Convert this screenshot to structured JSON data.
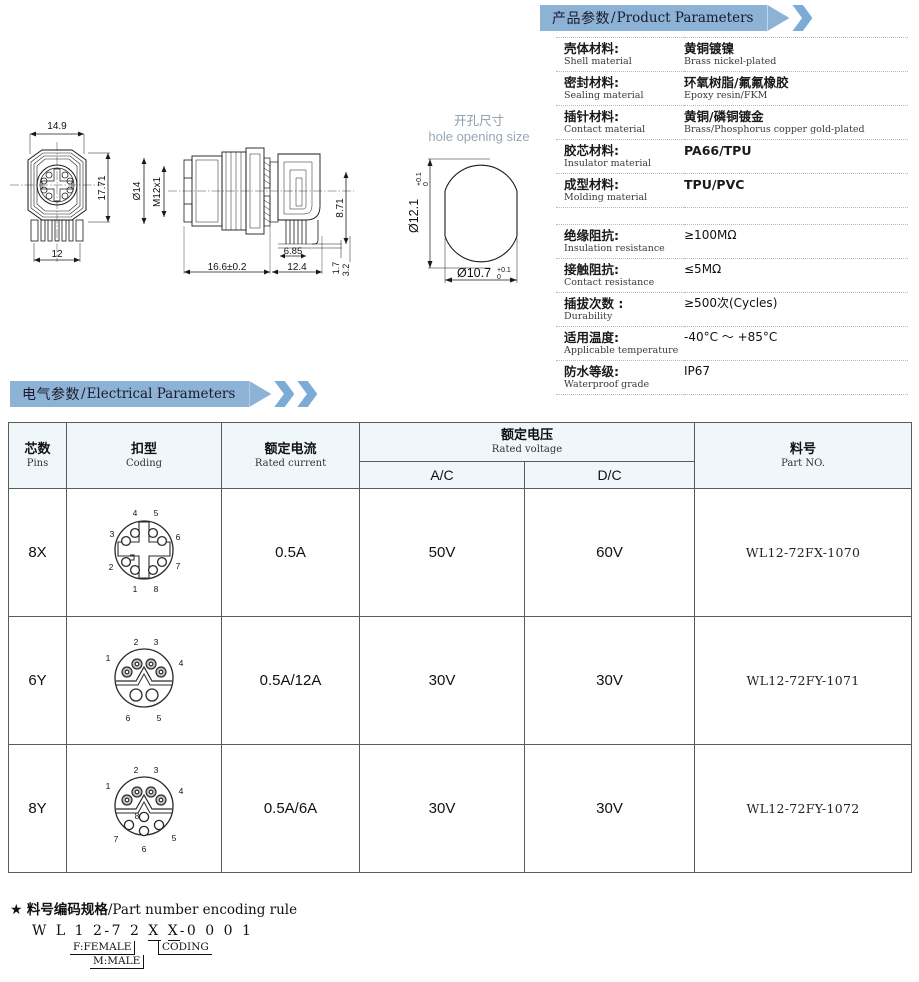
{
  "product_parameters": {
    "banner": {
      "cn": "产品参数",
      "sep": "/",
      "en": "Product Parameters"
    },
    "materials": [
      {
        "label_cn": "壳体材料:",
        "label_en": "Shell material",
        "value_cn": "黄铜镀镍",
        "value_en": "Brass nickel-plated"
      },
      {
        "label_cn": "密封材料:",
        "label_en": "Sealing material",
        "value_cn": "环氧树脂/氟氟橡胶",
        "value_en": "Epoxy resin/FKM"
      },
      {
        "label_cn": "插针材料:",
        "label_en": "Contact material",
        "value_cn": "黄铜/磷铜镀金",
        "value_en": "Brass/Phosphorus copper gold-plated"
      },
      {
        "label_cn": "胶芯材料:",
        "label_en": "Insulator material",
        "value_cn": "PA66/TPU",
        "value_en": ""
      },
      {
        "label_cn": "成型材料:",
        "label_en": "Molding material",
        "value_cn": "TPU/PVC",
        "value_en": ""
      }
    ],
    "specs": [
      {
        "label_cn": "绝缘阻抗:",
        "label_en": "Insulation resistance",
        "value": "≥100MΩ"
      },
      {
        "label_cn": "接触阻抗:",
        "label_en": "Contact resistance",
        "value": "≤5MΩ"
      },
      {
        "label_cn": "插拔次数 :",
        "label_en": "Durability",
        "value": "≥500次(Cycles)"
      },
      {
        "label_cn": "适用温度:",
        "label_en": "Applicable temperature",
        "value": "-40°C ～ +85°C"
      },
      {
        "label_cn": "防水等级:",
        "label_en": "Waterproof grade",
        "value": "IP67"
      }
    ]
  },
  "electrical_parameters": {
    "banner": {
      "cn": "电气参数",
      "sep": "/",
      "en": "Electrical Parameters"
    },
    "headers": {
      "pins_cn": "芯数",
      "pins_en": "Pins",
      "coding_cn": "扣型",
      "coding_en": "Coding",
      "current_cn": "额定电流",
      "current_en": "Rated current",
      "voltage_cn": "额定电压",
      "voltage_en": "Rated voltage",
      "ac": "A/C",
      "dc": "D/C",
      "partno_cn": "料号",
      "partno_en": "Part NO."
    },
    "rows": [
      {
        "pins": "8X",
        "coding": "x-coding-8pin",
        "current": "0.5A",
        "ac": "50V",
        "dc": "60V",
        "part_no": "WL12-72FX-1070"
      },
      {
        "pins": "6Y",
        "coding": "y-coding-6pin",
        "current": "0.5A/12A",
        "ac": "30V",
        "dc": "30V",
        "part_no": "WL12-72FY-1071"
      },
      {
        "pins": "8Y",
        "coding": "y-coding-8pin",
        "current": "0.5A/6A",
        "ac": "30V",
        "dc": "30V",
        "part_no": "WL12-72FY-1072"
      }
    ]
  },
  "encoding_rule": {
    "star": "★",
    "title_cn": "料号编码规格",
    "title_sep": "/",
    "title_en": "Part number encoding rule",
    "code": "W L 1 2-7 2 X X-0 0 0 1",
    "code_prefix": "W L 1 2-7 2 ",
    "code_gender": "X",
    "code_mid": " ",
    "code_coding": "X",
    "code_suffix": "-0 0 0 1",
    "legend_female": "F:FEMALE",
    "legend_male": "M:MALE",
    "legend_coding": "CODING"
  },
  "drawings": {
    "front_view": {
      "dim_width": "14.9",
      "dim_height": "17.71",
      "dim_pins": "12"
    },
    "side_view": {
      "dim_dia": "Ø14",
      "dim_thread": "M12x1",
      "dim_len": "16.6±0.2",
      "dim_len2": "12.4",
      "dim_pitch": "6.85",
      "dim_h1": "8.71",
      "dim_h2": "1.7",
      "dim_h3": "3.2"
    },
    "panel_cutout": {
      "title_cn": "开孔尺寸",
      "title_en": "hole opening size",
      "dim_v": "Ø12.1",
      "dim_v_tol_up": "+0.1",
      "dim_v_tol_dn": "0",
      "dim_h": "Ø10.7",
      "dim_h_tol_up": "+0.1",
      "dim_h_tol_dn": "0"
    }
  },
  "colors": {
    "banner": "#8cb2d6",
    "banner_chevron": "#7cabd8",
    "table_header_bg": "#f0f7fb",
    "table_border": "#5b5b5b",
    "drawing_line": "#1a1a1a",
    "drawing_label": "#9aa7b4"
  }
}
